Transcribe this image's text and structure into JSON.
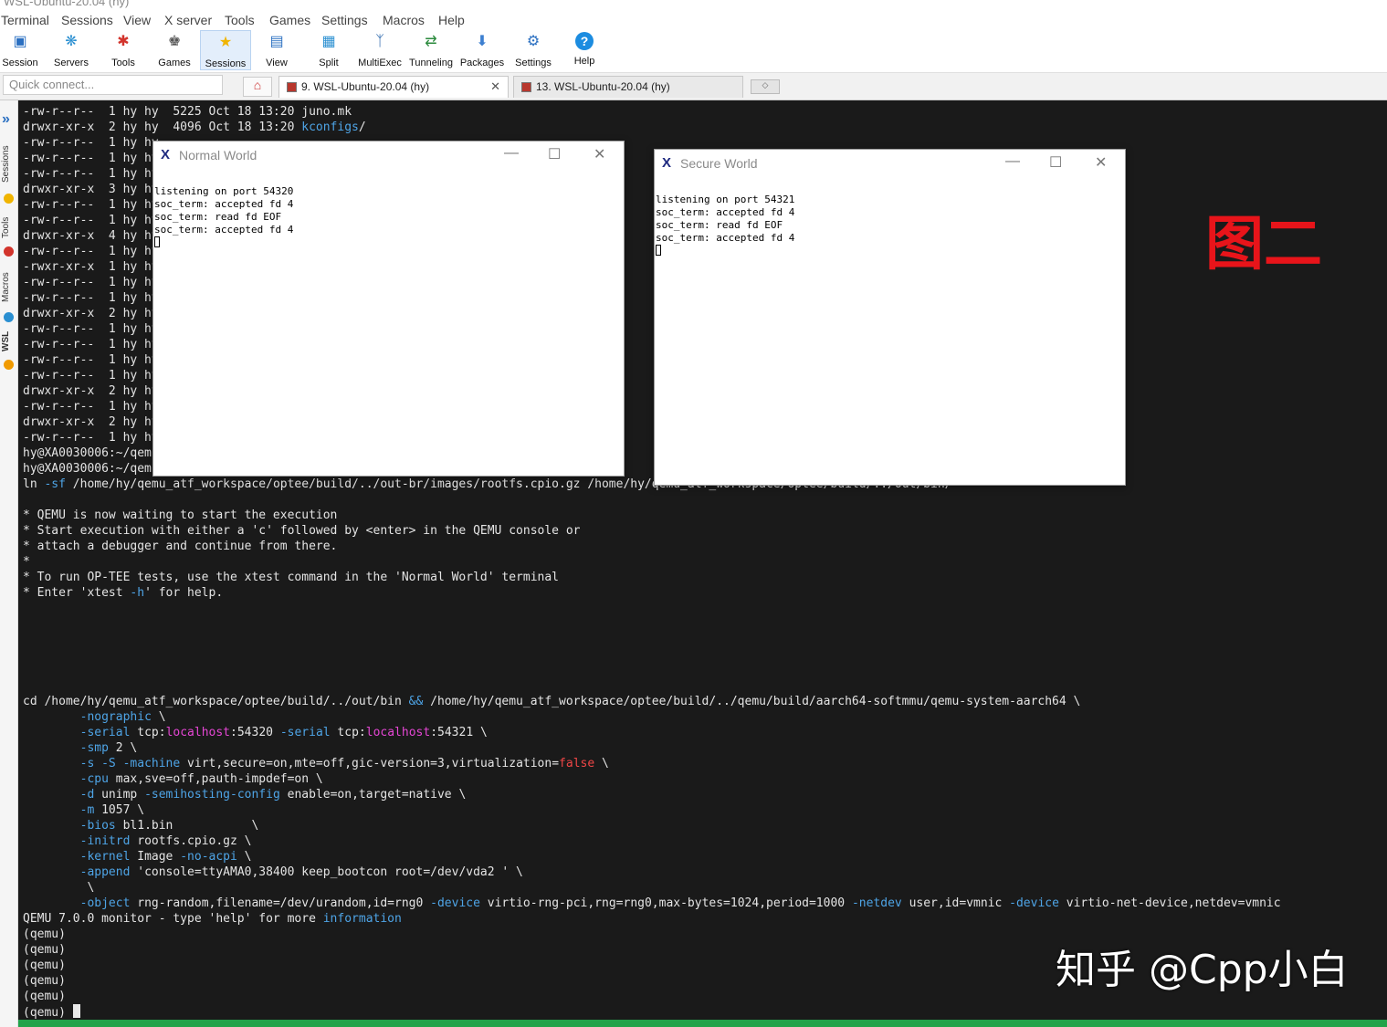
{
  "window": {
    "title": "WSL-Ubuntu-20.04 (hy)"
  },
  "menu": [
    "Terminal",
    "Sessions",
    "View",
    "X server",
    "Tools",
    "Games",
    "Settings",
    "Macros",
    "Help"
  ],
  "toolbar": [
    {
      "label": "Session",
      "icon": "session-icon"
    },
    {
      "label": "Servers",
      "icon": "servers-icon"
    },
    {
      "label": "Tools",
      "icon": "tools-icon"
    },
    {
      "label": "Games",
      "icon": "games-icon"
    },
    {
      "label": "Sessions",
      "icon": "star-icon"
    },
    {
      "label": "View",
      "icon": "view-icon"
    },
    {
      "label": "Split",
      "icon": "split-icon"
    },
    {
      "label": "MultiExec",
      "icon": "multiexec-icon"
    },
    {
      "label": "Tunneling",
      "icon": "tunneling-icon"
    },
    {
      "label": "Packages",
      "icon": "packages-icon"
    },
    {
      "label": "Settings",
      "icon": "gear-icon"
    },
    {
      "label": "Help",
      "icon": "help-icon"
    }
  ],
  "quick_connect": {
    "placeholder": "Quick connect..."
  },
  "tabs": [
    {
      "label": "9. WSL-Ubuntu-20.04 (hy)",
      "active": true
    },
    {
      "label": "13. WSL-Ubuntu-20.04 (hy)",
      "active": false
    }
  ],
  "sidebar": [
    "Sessions",
    "Tools",
    "Macros",
    "WSL"
  ],
  "terminal": {
    "listing": [
      {
        "perm": "-rw-r--r--",
        "links": "1",
        "owner": "hy",
        "group": "hy",
        "size": "5225",
        "date": "Oct 18 13:20",
        "name": "juno.mk",
        "dir": false
      },
      {
        "perm": "drwxr-xr-x",
        "links": "2",
        "owner": "hy",
        "group": "hy",
        "size": "4096",
        "date": "Oct 18 13:20",
        "name": "kconfigs",
        "dir": true
      },
      {
        "perm": "-rw-r--r--",
        "links": "1",
        "owner": "hy",
        "group": "hy"
      },
      {
        "perm": "-rw-r--r--",
        "links": "1",
        "owner": "hy",
        "group": "hy"
      },
      {
        "perm": "-rw-r--r--",
        "links": "1",
        "owner": "hy",
        "group": "hy"
      },
      {
        "perm": "drwxr-xr-x",
        "links": "3",
        "owner": "hy",
        "group": "hy"
      },
      {
        "perm": "-rw-r--r--",
        "links": "1",
        "owner": "hy",
        "group": "hy"
      },
      {
        "perm": "-rw-r--r--",
        "links": "1",
        "owner": "hy",
        "group": "hy"
      },
      {
        "perm": "drwxr-xr-x",
        "links": "4",
        "owner": "hy",
        "group": "hy"
      },
      {
        "perm": "-rw-r--r--",
        "links": "1",
        "owner": "hy",
        "group": "hy"
      },
      {
        "perm": "-rwxr-xr-x",
        "links": "1",
        "owner": "hy",
        "group": "hy"
      },
      {
        "perm": "-rw-r--r--",
        "links": "1",
        "owner": "hy",
        "group": "hy"
      },
      {
        "perm": "-rw-r--r--",
        "links": "1",
        "owner": "hy",
        "group": "hy"
      },
      {
        "perm": "drwxr-xr-x",
        "links": "2",
        "owner": "hy",
        "group": "hy"
      },
      {
        "perm": "-rw-r--r--",
        "links": "1",
        "owner": "hy",
        "group": "hy"
      },
      {
        "perm": "-rw-r--r--",
        "links": "1",
        "owner": "hy",
        "group": "hy"
      },
      {
        "perm": "-rw-r--r--",
        "links": "1",
        "owner": "hy",
        "group": "hy"
      },
      {
        "perm": "-rw-r--r--",
        "links": "1",
        "owner": "hy",
        "group": "hy"
      },
      {
        "perm": "drwxr-xr-x",
        "links": "2",
        "owner": "hy",
        "group": "hy"
      },
      {
        "perm": "-rw-r--r--",
        "links": "1",
        "owner": "hy",
        "group": "hy"
      },
      {
        "perm": "drwxr-xr-x",
        "links": "2",
        "owner": "hy",
        "group": "hy"
      },
      {
        "perm": "-rw-r--r--",
        "links": "1",
        "owner": "hy",
        "group": "hy"
      }
    ],
    "prompt1": "hy@XA0030006:~/qemu",
    "prompt2": "hy@XA0030006:~/qemu",
    "ln_cmd": "ln",
    "ln_flag": "-sf",
    "ln_args": " /home/hy/qemu_atf_workspace/optee/build/../out-br/images/rootfs.cpio.gz /home/hy/qemu_atf_workspace/optee/build/../out/bin/",
    "info": [
      "* QEMU is now waiting to start the execution",
      "* Start execution with either a 'c' followed by <enter> in the QEMU console or",
      "* attach a debugger and continue from there.",
      "*",
      "* To run OP-TEE tests, use the xtest command in the 'Normal World' terminal"
    ],
    "help_pre": "* Enter 'xtest ",
    "help_flag": "-h",
    "help_post": "' for help.",
    "cd_pre": "cd /home/hy/qemu_atf_workspace/optee/build/../out/bin ",
    "cd_and": "&&",
    "cd_post": " /home/hy/qemu_atf_workspace/optee/build/../qemu/build/aarch64-softmmu/qemu-system-aarch64 \\",
    "qemu_version_line": "QEMU 7.0.0 monitor - type 'help' for more ",
    "qemu_info_word": "information",
    "qemu_prompts": [
      "(qemu)",
      "(qemu)",
      "(qemu)",
      "(qemu)",
      "(qemu)",
      "(qemu)"
    ]
  },
  "normal_world": {
    "title": "Normal World",
    "lines": [
      "listening on port 54320",
      "soc_term: accepted fd 4",
      "soc_term: read fd EOF",
      "soc_term: accepted fd 4"
    ]
  },
  "secure_world": {
    "title": "Secure World",
    "lines": [
      "listening on port 54321",
      "soc_term: accepted fd 4",
      "soc_term: read fd EOF",
      "soc_term: accepted fd 4"
    ]
  },
  "annotation": "图二",
  "watermark": "知乎 @Cpp小白",
  "colors": {
    "terminal_bg": "#1a1a1a",
    "flag": "#4ea4e6",
    "host": "#e546d4",
    "false_kw": "#ef4646",
    "status_bar": "#22a34a",
    "annotation": "#e8141a"
  }
}
